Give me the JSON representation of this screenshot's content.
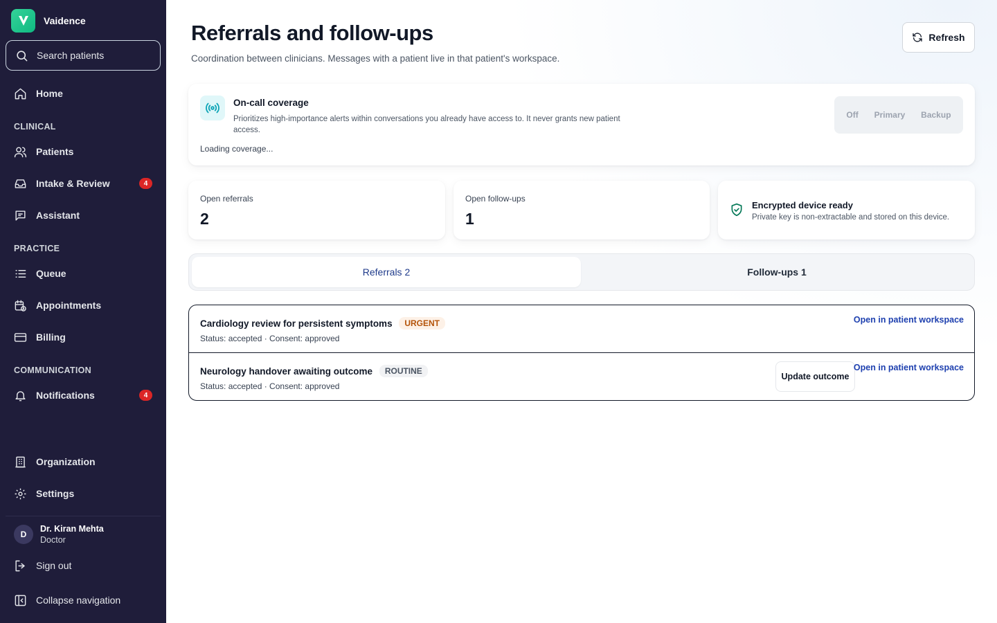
{
  "app": {
    "name": "Vaidence"
  },
  "search": {
    "placeholder": "Search patients"
  },
  "nav": {
    "home": "Home",
    "section_clinical": "CLINICAL",
    "patients": "Patients",
    "intake": "Intake & Review",
    "intake_badge": "4",
    "assistant": "Assistant",
    "section_practice": "PRACTICE",
    "queue": "Queue",
    "appointments": "Appointments",
    "billing": "Billing",
    "section_communication": "COMMUNICATION",
    "notifications": "Notifications",
    "notifications_badge": "4",
    "organization": "Organization",
    "settings": "Settings",
    "sign_out": "Sign out",
    "collapse": "Collapse navigation"
  },
  "user": {
    "initial": "D",
    "name": "Dr. Kiran Mehta",
    "role": "Doctor"
  },
  "page": {
    "title": "Referrals and follow-ups",
    "subtitle": "Coordination between clinicians. Messages with a patient live in that patient's workspace.",
    "refresh_label": "Refresh"
  },
  "oncall": {
    "title": "On-call coverage",
    "description": "Prioritizes high-importance alerts within conversations you already have access to. It never grants new patient access.",
    "status": "Loading coverage...",
    "options": [
      "Off",
      "Primary",
      "Backup"
    ]
  },
  "stats": {
    "open_referrals_label": "Open referrals",
    "open_referrals_value": "2",
    "open_followups_label": "Open follow-ups",
    "open_followups_value": "1",
    "device_title": "Encrypted device ready",
    "device_desc": "Private key is non-extractable and stored on this device."
  },
  "tabs": {
    "referrals": "Referrals 2",
    "followups": "Follow-ups 1"
  },
  "referrals": [
    {
      "title": "Cardiology review for persistent symptoms",
      "priority": "URGENT",
      "meta": "Status: accepted · Consent: approved",
      "link": "Open in patient workspace"
    },
    {
      "title": "Neurology handover awaiting outcome",
      "priority": "ROUTINE",
      "meta": "Status: accepted · Consent: approved",
      "link": "Open in patient workspace",
      "action": "Update outcome"
    }
  ],
  "colors": {
    "sidebar": "#1f1d3a",
    "accent": "#1e40af",
    "badge": "#dc2626",
    "brand": "#10b981",
    "urgent": "#b45309"
  }
}
